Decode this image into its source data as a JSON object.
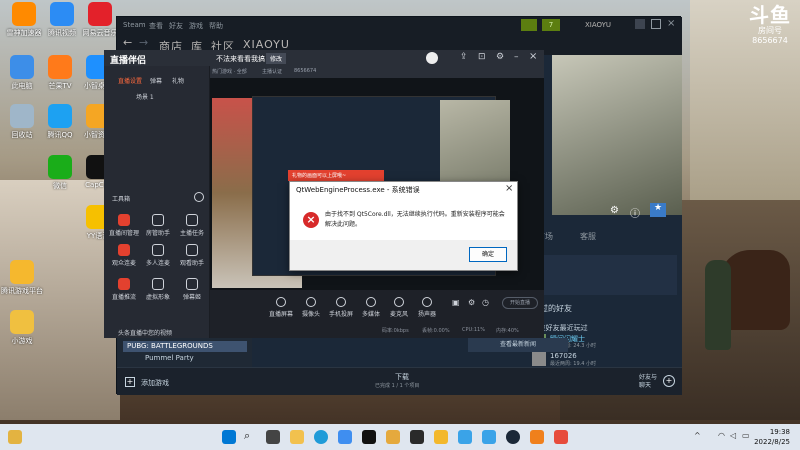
{
  "desktop": {
    "icons": [
      {
        "label": "雷神加速器",
        "color": "#ff8a00"
      },
      {
        "label": "腾讯视频",
        "color": "#2c8cf4"
      },
      {
        "label": "网易云音乐",
        "color": "#e3212a"
      },
      {
        "label": "此电脑",
        "color": "#3d8ee8"
      },
      {
        "label": "芒果TV",
        "color": "#ff7a1a"
      },
      {
        "label": "小智桌面",
        "color": "#1e90ff"
      },
      {
        "label": "回收站",
        "color": "#9fb6c9"
      },
      {
        "label": "腾讯QQ",
        "color": "#1da1f2"
      },
      {
        "label": "小智资源",
        "color": "#f5a623"
      },
      {
        "label": "CapCut",
        "color": "#111111"
      },
      {
        "label": "微信",
        "color": "#1aad19"
      },
      {
        "label": "YY语音",
        "color": "#f6c000"
      },
      {
        "label": "腾讯游戏平台",
        "color": "#f5b82e"
      },
      {
        "label": "小游戏",
        "color": "#f0c040"
      }
    ],
    "watermark": {
      "title": "斗鱼",
      "subtitle": "房间号",
      "room": "8656674"
    }
  },
  "steam": {
    "title": "Steam",
    "menu": [
      "Steam",
      "查看",
      "好友",
      "游戏",
      "帮助"
    ],
    "nav": [
      "商店",
      "库",
      "社区",
      "XIAOYU"
    ],
    "user": "XIAOYU",
    "wallet_badge": "7",
    "library_item": "PUBG: BATTLEGROUNDS",
    "library_item2": "Pummel Party",
    "tabs": [
      "市场",
      "客服"
    ],
    "friends_title": "玩过的好友",
    "friends_count": "6 位好友最近玩过",
    "friend1_name": "瞬间闪耀士",
    "friend1_sub": "最近两周: 24.3 小时",
    "friend2_name": "167026",
    "friend2_sub": "最近两周: 19.4 小时",
    "news_btn": "查看最新新闻",
    "download_label": "下载",
    "download_sub": "已完成 1 / 1 个项目",
    "friends_chat": "好友与\n聊天",
    "add_game": "添加游戏"
  },
  "overlay": {
    "brand": "直播伴侣",
    "tabs": [
      "直播设置",
      "弹幕",
      "礼物"
    ],
    "room_title": "不法来看看我搞",
    "room_tag": "修改",
    "meta": [
      "热门游戏 · 全部",
      "主播认证",
      "8656674"
    ],
    "scene": "场景 1",
    "tools_title": "工具箱",
    "tools": [
      {
        "label": "直播间管理",
        "red": true
      },
      {
        "label": "房管助手",
        "red": false
      },
      {
        "label": "主播任务",
        "red": false
      },
      {
        "label": "观众连麦",
        "red": true
      },
      {
        "label": "多人连麦",
        "red": false
      },
      {
        "label": "观看助手",
        "red": false
      },
      {
        "label": "直播推流",
        "red": true
      },
      {
        "label": "虚拟形象",
        "red": false
      },
      {
        "label": "弹幕姬",
        "red": false
      }
    ],
    "notice": "头条直播中您的视频",
    "controls": [
      "直播屏幕",
      "摄像头",
      "手机投屏",
      "多媒体",
      "麦克风",
      "扬声器"
    ],
    "status": [
      "码率:0kbps",
      "丢帧:0.00%",
      "CPU:11%",
      "内存:40%"
    ],
    "start_btn": "开始直播",
    "popup": "礼物的画面可以上屏哦~"
  },
  "dialog": {
    "title": "QtWebEngineProcess.exe - 系统错误",
    "message": "由于找不到 Qt5Core.dll，无法继续执行代码。重新安装程序可能会解决此问题。",
    "ok": "确定"
  },
  "taskbar": {
    "time": "19:38",
    "date": "2022/8/25"
  }
}
